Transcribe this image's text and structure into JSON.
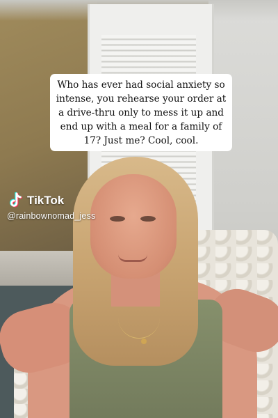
{
  "caption": {
    "text": "Who has ever had social anxiety so intense, you rehearse your order at a drive-thru only to mess it up and end up with a meal for a family of 17? Just me? Cool, cool."
  },
  "watermark": {
    "brand": "TikTok",
    "username": "@rainbownomad_jess",
    "icon": "tiktok-note-icon",
    "colors": {
      "cyan": "#25f4ee",
      "red": "#fe2c55",
      "white": "#ffffff"
    }
  }
}
